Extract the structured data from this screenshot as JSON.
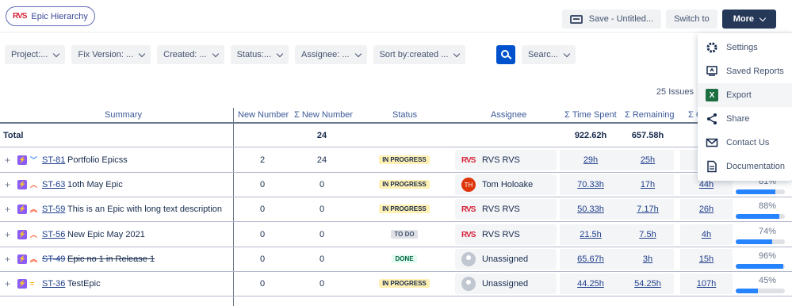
{
  "brand": {
    "logo_text": "RVS",
    "label": "Epic Hierarchy"
  },
  "toolbar": {
    "save_label": "Save - Untitled...",
    "switch_label": "Switch to",
    "more_label": "More"
  },
  "filters": [
    {
      "label": "Project:..."
    },
    {
      "label": "Fix Version: ..."
    },
    {
      "label": "Created: ..."
    },
    {
      "label": "Status:..."
    },
    {
      "label": "Assignee: ..."
    },
    {
      "label": "Sort by:created ..."
    }
  ],
  "search_label": "Searc...",
  "issues_count": "25 Issues",
  "table": {
    "headers": {
      "summary": "Summary",
      "new_number": "New Number",
      "sum_new_number": "Σ New Number",
      "status": "Status",
      "assignee": "Assignee",
      "time_spent": "Σ Time Spent",
      "remaining": "Σ Remaining",
      "sum_cut": "Σ C"
    },
    "total": {
      "label": "Total",
      "sum_new_number": "24",
      "time_spent": "922.62h",
      "remaining": "657.58h"
    },
    "rows": [
      {
        "key": "ST-81",
        "summary": "Portfolio Epicss",
        "new_number": "2",
        "sum_new_number": "24",
        "status": "IN PROGRESS",
        "status_kind": "progress",
        "assignee": "RVS RVS",
        "avatar": "logo",
        "avatar_text": "RVS",
        "time_spent": "29h",
        "remaining": "25h",
        "extra": "",
        "pct": "",
        "progress": 0,
        "strike": false,
        "priority": "low"
      },
      {
        "key": "ST-63",
        "summary": "1oth May Epic",
        "new_number": "0",
        "sum_new_number": "0",
        "status": "IN PROGRESS",
        "status_kind": "progress",
        "assignee": "Tom Holoake",
        "avatar": "initials",
        "avatar_text": "TH",
        "time_spent": "70.33h",
        "remaining": "17h",
        "extra": "44h",
        "pct": "81%",
        "progress": 81,
        "strike": false,
        "priority": "medium-high"
      },
      {
        "key": "ST-59",
        "summary": "This is an Epic with long text description",
        "new_number": "0",
        "sum_new_number": "0",
        "status": "IN PROGRESS",
        "status_kind": "progress",
        "assignee": "RVS RVS",
        "avatar": "logo",
        "avatar_text": "RVS",
        "time_spent": "50.33h",
        "remaining": "7.17h",
        "extra": "26h",
        "pct": "88%",
        "progress": 88,
        "strike": false,
        "priority": "high"
      },
      {
        "key": "ST-56",
        "summary": "New Epic May 2021",
        "new_number": "0",
        "sum_new_number": "0",
        "status": "TO DO",
        "status_kind": "todo",
        "assignee": "RVS RVS",
        "avatar": "logo",
        "avatar_text": "RVS",
        "time_spent": "21.5h",
        "remaining": "7.5h",
        "extra": "4h",
        "pct": "74%",
        "progress": 74,
        "strike": false,
        "priority": "medium-high"
      },
      {
        "key": "ST-49",
        "summary": "Epic no 1 in Release 1",
        "new_number": "0",
        "sum_new_number": "0",
        "status": "DONE",
        "status_kind": "done",
        "assignee": "Unassigned",
        "avatar": "none",
        "avatar_text": "",
        "time_spent": "65.67h",
        "remaining": "3h",
        "extra": "15h",
        "pct": "96%",
        "progress": 96,
        "strike": true,
        "priority": "high"
      },
      {
        "key": "ST-36",
        "summary": "TestEpic",
        "new_number": "0",
        "sum_new_number": "0",
        "status": "IN PROGRESS",
        "status_kind": "progress",
        "assignee": "Unassigned",
        "avatar": "none",
        "avatar_text": "",
        "time_spent": "44.25h",
        "remaining": "54.25h",
        "extra": "107h",
        "pct": "45%",
        "progress": 45,
        "strike": false,
        "priority": "medium"
      }
    ]
  },
  "menu": {
    "items": [
      {
        "label": "Settings",
        "icon": "gear-icon"
      },
      {
        "label": "Saved Reports",
        "icon": "saved-reports-icon"
      },
      {
        "label": "Export",
        "icon": "excel-icon",
        "icon_text": "X"
      },
      {
        "label": "Share",
        "icon": "share-icon"
      },
      {
        "label": "Contact Us",
        "icon": "mail-icon"
      },
      {
        "label": "Documentation",
        "icon": "document-icon"
      }
    ]
  },
  "colors": {
    "primary_button": "#253858",
    "link": "#2f6fd0",
    "progress": "#2684ff",
    "search_button": "#0052cc"
  }
}
